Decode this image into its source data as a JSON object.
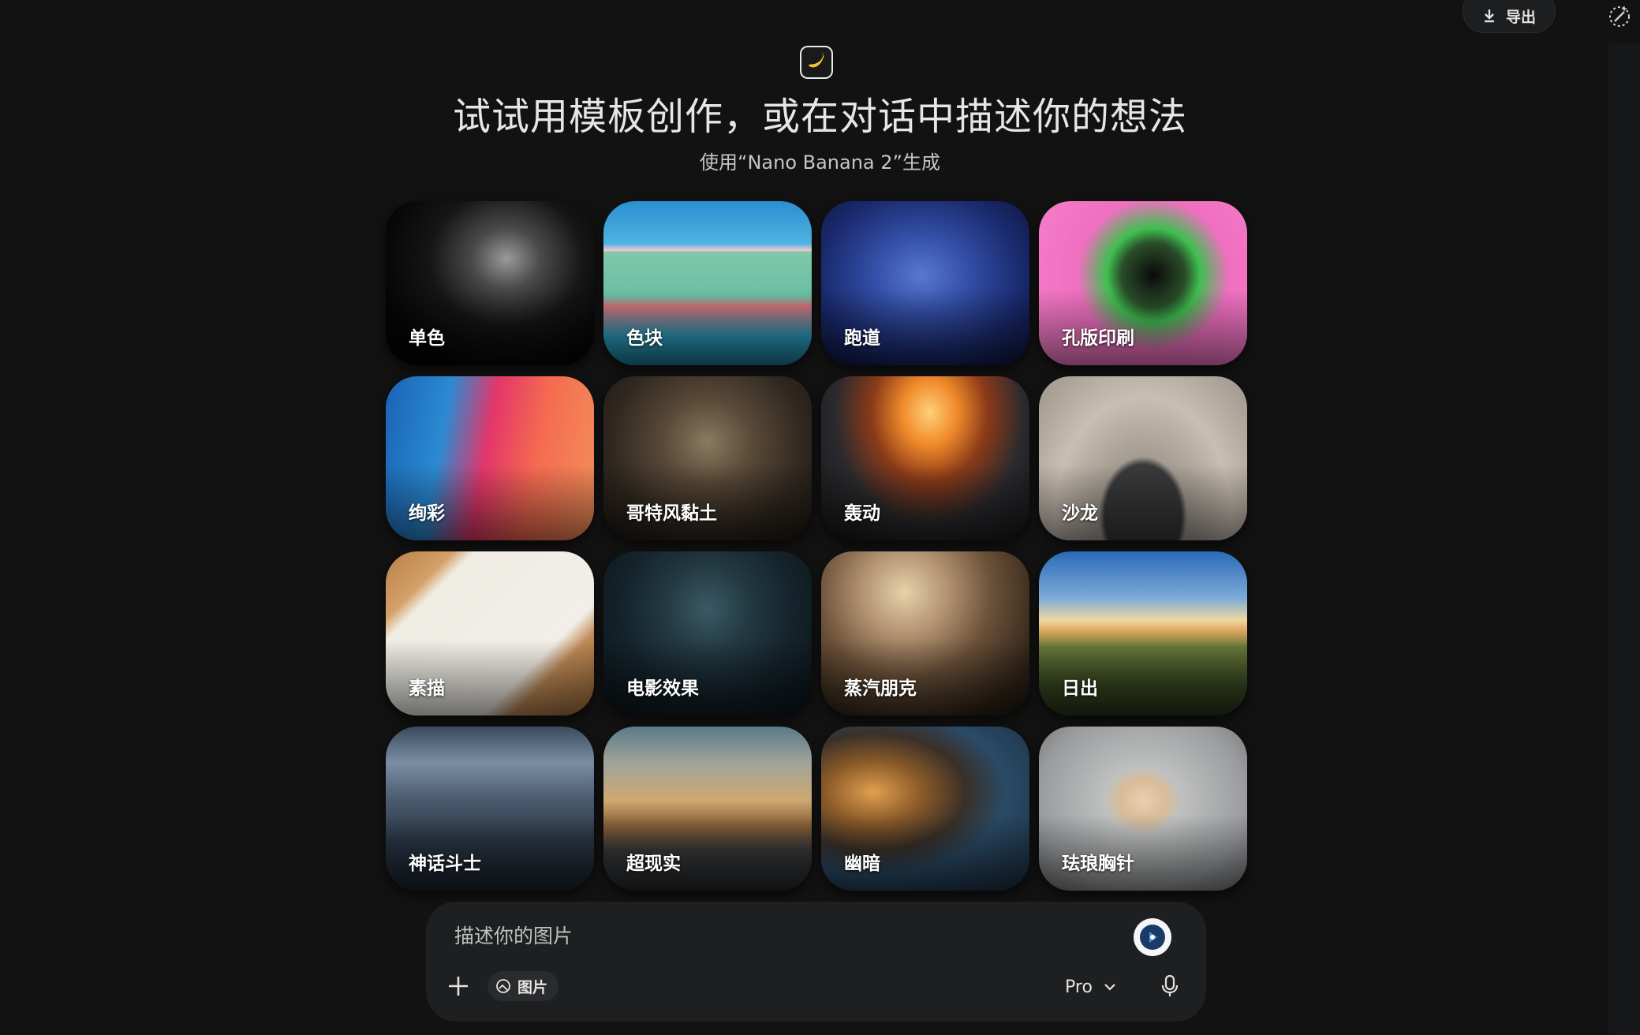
{
  "header": {
    "export_label": "导出",
    "export_icon": "download-icon",
    "new_chat_icon": "edit-sparkle-icon"
  },
  "hero": {
    "icon": "banana-icon",
    "title": "试试用模板创作，或在对话中描述你的想法",
    "subtitle": "使用“Nano Banana 2”生成"
  },
  "templates": [
    {
      "label": "单色"
    },
    {
      "label": "色块"
    },
    {
      "label": "跑道"
    },
    {
      "label": "孔版印刷"
    },
    {
      "label": "绚彩"
    },
    {
      "label": "哥特风黏土"
    },
    {
      "label": "轰动"
    },
    {
      "label": "沙龙"
    },
    {
      "label": "素描"
    },
    {
      "label": "电影效果"
    },
    {
      "label": "蒸汽朋克"
    },
    {
      "label": "日出"
    },
    {
      "label": "神话斗士"
    },
    {
      "label": "超现实"
    },
    {
      "label": "幽暗"
    },
    {
      "label": "珐琅胸针"
    }
  ],
  "composer": {
    "placeholder": "描述你的图片",
    "image_chip_label": "图片",
    "model_label": "Pro",
    "icons": [
      "plus-icon",
      "image-icon",
      "chevron-down-icon",
      "mic-icon",
      "send-icon"
    ]
  },
  "colors": {
    "background": "#121212",
    "composer_bg": "#1e1f20",
    "text": "#e3e3e3"
  }
}
